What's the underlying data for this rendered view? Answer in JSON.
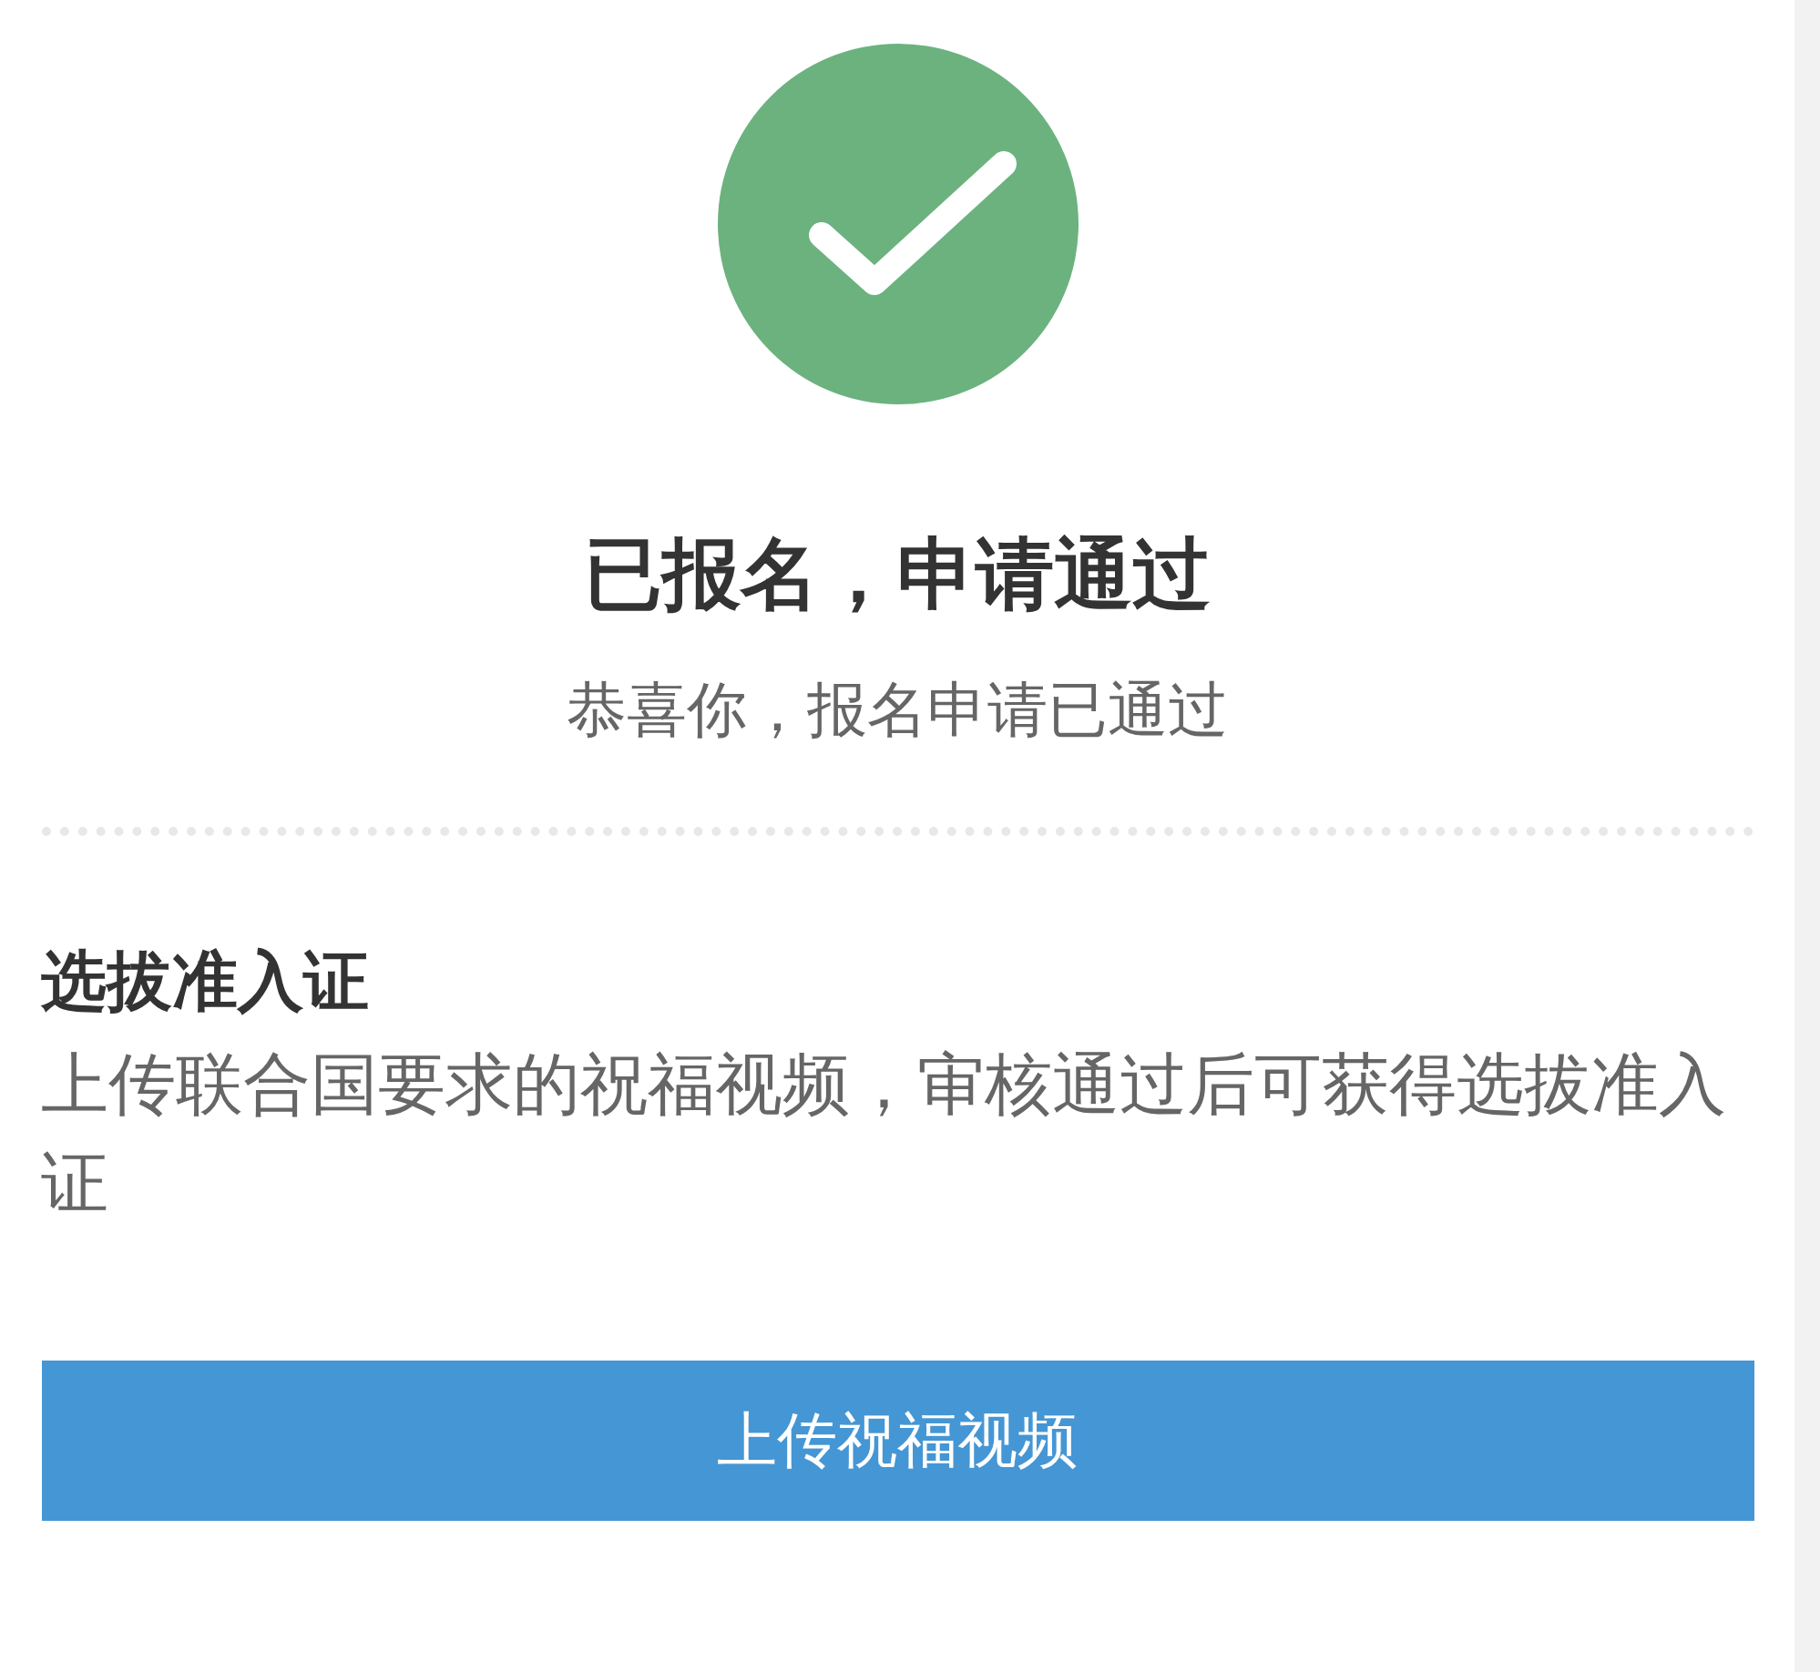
{
  "status": {
    "title": "已报名，申请通过",
    "subtitle": "恭喜你，报名申请已通过"
  },
  "section": {
    "title": "选拔准入证",
    "description": "上传联合国要求的祝福视频，审核通过后可获得选拔准入证"
  },
  "button": {
    "label": "上传祝福视频"
  }
}
